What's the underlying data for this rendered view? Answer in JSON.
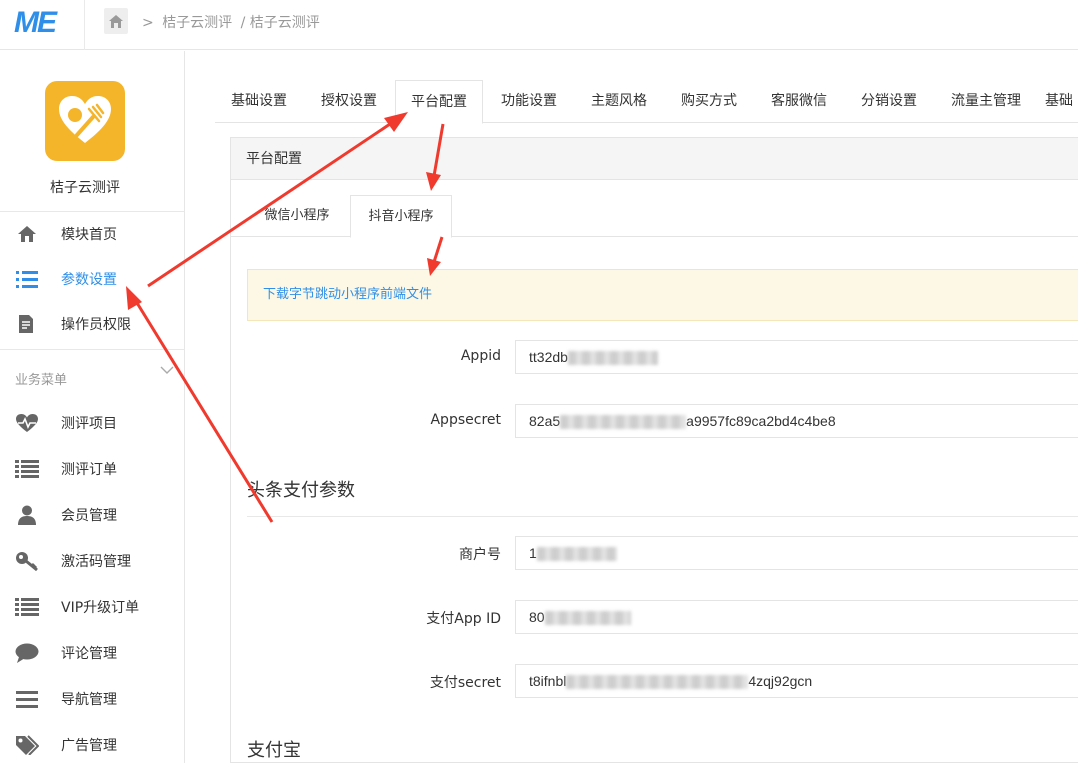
{
  "header": {
    "logo_text": "ME",
    "breadcrumb": [
      "桔子云测评",
      "/ 桔子云测评"
    ],
    "accent_color": "#2f8fe8"
  },
  "sidebar": {
    "app_name": "桔子云测评",
    "app_icon": "heart-fork-icon",
    "top_items": [
      {
        "label": "模块首页",
        "icon": "home-icon"
      },
      {
        "label": "参数设置",
        "icon": "list-icon",
        "active": true
      },
      {
        "label": "操作员权限",
        "icon": "document-edit-icon"
      }
    ],
    "group_title": "业务菜单",
    "group_items": [
      {
        "label": "测评项目",
        "icon": "heartbeat-icon"
      },
      {
        "label": "测评订单",
        "icon": "list-lines-icon"
      },
      {
        "label": "会员管理",
        "icon": "user-icon"
      },
      {
        "label": "激活码管理",
        "icon": "key-icon"
      },
      {
        "label": "VIP升级订单",
        "icon": "list-lines-icon"
      },
      {
        "label": "评论管理",
        "icon": "comment-icon"
      },
      {
        "label": "导航管理",
        "icon": "menu-icon"
      },
      {
        "label": "广告管理",
        "icon": "tags-icon"
      }
    ]
  },
  "tabs": [
    {
      "label": "基础设置"
    },
    {
      "label": "授权设置"
    },
    {
      "label": "平台配置",
      "active": true
    },
    {
      "label": "功能设置"
    },
    {
      "label": "主题风格"
    },
    {
      "label": "购买方式"
    },
    {
      "label": "客服微信"
    },
    {
      "label": "分销设置"
    },
    {
      "label": "流量主管理"
    },
    {
      "label": "基础"
    }
  ],
  "panel": {
    "title": "平台配置",
    "subtabs": [
      {
        "label": "微信小程序"
      },
      {
        "label": "抖音小程序",
        "active": true
      }
    ],
    "notice_link": "下载字节跳动小程序前端文件",
    "fields": [
      {
        "label": "Appid",
        "value_prefix": "tt32db",
        "value_suffix": ""
      },
      {
        "label": "Appsecret",
        "value_prefix": "82a5",
        "value_suffix": "a9957fc89ca2bd4c4be8"
      }
    ],
    "section_pay": "头条支付参数",
    "pay_fields": [
      {
        "label": "商户号",
        "value_prefix": "1",
        "value_suffix": ""
      },
      {
        "label": "支付App ID",
        "value_prefix": "80",
        "value_suffix": ""
      },
      {
        "label": "支付secret",
        "value_prefix": "t8ifnbl",
        "value_suffix": "4zqj92gcn"
      }
    ],
    "section_alipay": "支付宝"
  },
  "annotation_color": "#f03a2e"
}
